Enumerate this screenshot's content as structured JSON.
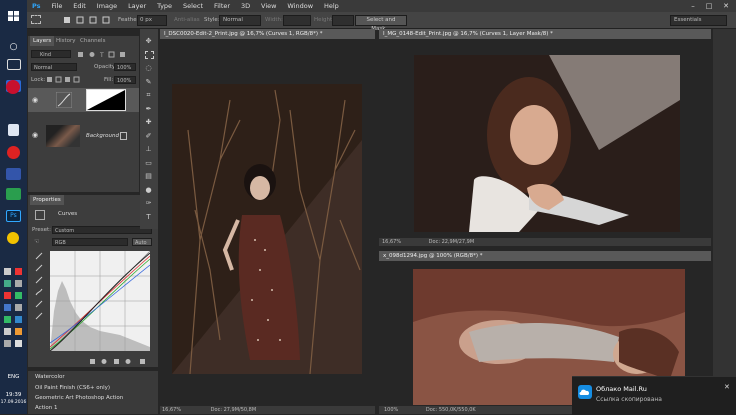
{
  "taskbar": {
    "lang": "ENG",
    "time": "19:39",
    "date": "17.09.2016"
  },
  "menubar": {
    "logo": "Ps",
    "items": [
      "File",
      "Edit",
      "Image",
      "Layer",
      "Type",
      "Select",
      "Filter",
      "3D",
      "View",
      "Window",
      "Help"
    ]
  },
  "options": {
    "feather_label": "Feather:",
    "feather_value": "0 px",
    "antialias_label": "Anti-alias",
    "style_label": "Style:",
    "style_value": "Normal",
    "width_label": "Width:",
    "height_label": "Height:",
    "select_mask": "Select and Mask...",
    "workspace": "Essentials"
  },
  "layers_panel": {
    "tabs": [
      "Layers",
      "History",
      "Channels"
    ],
    "kind_label": "Kind",
    "blend_mode": "Normal",
    "opacity_label": "Opacity:",
    "opacity_value": "100%",
    "lock_label": "Lock:",
    "fill_label": "Fill:",
    "fill_value": "100%",
    "background_layer": "Background"
  },
  "properties_panel": {
    "title": "Properties",
    "curves_label": "Curves",
    "preset_label": "Preset:",
    "preset_value": "Custom",
    "channel_value": "RGB",
    "auto_label": "Auto"
  },
  "actions_list": [
    "Watercolor",
    "Oil Paint Finish (CS6+ only)",
    "Geometric Art Photoshop Action",
    "Action 1"
  ],
  "documents": {
    "doc1": {
      "title": "I_DSC0020-Edit-2_Print.jpg @ 16,7% (Curves 1, RGB/8*) *",
      "zoom": "16,67%",
      "info": "Doc: 27,9M/50,8M"
    },
    "doc2": {
      "title": "I_MG_0148-Edit_Print.jpg @ 16,7% (Curves 1, Layer Mask/8) *",
      "zoom": "16,67%",
      "info": "Doc: 22,9M/27,9M"
    },
    "doc3": {
      "title": "x_098d1294.jpg @ 100% (RGB/8*) *",
      "zoom": "100%",
      "info": "Doc: 550,0K/550,0K"
    }
  },
  "notification": {
    "title": "Облако Mail.Ru",
    "message": "Ссылка скопирована"
  }
}
